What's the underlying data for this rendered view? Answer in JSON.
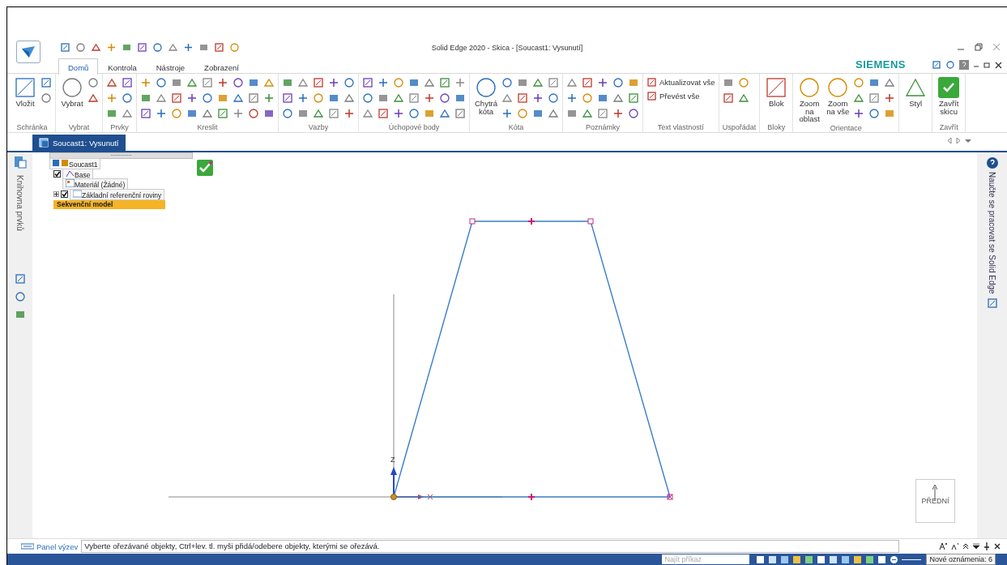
{
  "window": {
    "title": "Solid Edge 2020 - Skica - [Soucast1: Vysunutí]",
    "brand": "SIEMENS"
  },
  "tabs": [
    {
      "label": "Domů",
      "selected": true
    },
    {
      "label": "Kontrola",
      "selected": false
    },
    {
      "label": "Nástroje",
      "selected": false
    },
    {
      "label": "Zobrazení",
      "selected": false
    }
  ],
  "ribbon_groups": [
    {
      "label": "Schránka",
      "buttons": [
        {
          "label": "Vložit",
          "kind": "large"
        }
      ]
    },
    {
      "label": "Vybrat",
      "buttons": [
        {
          "label": "Vybrat",
          "kind": "large"
        }
      ]
    },
    {
      "label": "Prvky"
    },
    {
      "label": "Kreslit"
    },
    {
      "label": "Vazby"
    },
    {
      "label": "Úchopové body"
    },
    {
      "label": "Kóta",
      "buttons": [
        {
          "label": "Chytrá kóta",
          "kind": "large"
        }
      ]
    },
    {
      "label": "Poznámky"
    },
    {
      "label": "Text vlastností",
      "buttons": [
        {
          "label": "Aktualizovat vše",
          "kind": "small"
        },
        {
          "label": "Převést vše",
          "kind": "small"
        }
      ]
    },
    {
      "label": "Uspořádat"
    },
    {
      "label": "Bloky",
      "buttons": [
        {
          "label": "Blok",
          "kind": "large"
        }
      ]
    },
    {
      "label": "Orientace",
      "buttons": [
        {
          "label": "Zoom na oblast",
          "kind": "large"
        },
        {
          "label": "Zoom na vše",
          "kind": "large"
        }
      ]
    },
    {
      "buttons": [
        {
          "label": "Styl",
          "kind": "large"
        }
      ]
    },
    {
      "label": "Zavřít",
      "buttons": [
        {
          "label": "Zavřít skicu",
          "kind": "close"
        }
      ]
    }
  ],
  "side_panel": {
    "label": "Knihovna prvků"
  },
  "document_tabs": [
    {
      "label": "Soucast1: Vysunutí",
      "selected": true
    }
  ],
  "tree": [
    {
      "label": "Soucast1",
      "kind": "part",
      "children": [
        {
          "label": "Base",
          "kind": "sketch",
          "checked": true
        },
        {
          "label": "Materiál (Žádné)",
          "kind": "material"
        },
        {
          "label": "Základní referenční roviny",
          "kind": "planes",
          "checked": true,
          "expanded": false
        },
        {
          "label": "Sekvenční model",
          "kind": "marker"
        }
      ]
    }
  ],
  "canvas": {
    "axis_label": "Z",
    "view_cube": "PŘEDNÍ"
  },
  "help_panel": {
    "label": "Naučte se pracovat se Solid Edge"
  },
  "prompt_bar": {
    "label": "Panel výzev",
    "prompt": "Vyberte ořezávané objekty, Ctrl+lev. tl. myši přidá/odebere objekty, kterými se ořezává."
  },
  "status_bar": {
    "search": {
      "placeholder": "Najít příkaz"
    },
    "notifications": "Nové oznámenia: 6"
  }
}
